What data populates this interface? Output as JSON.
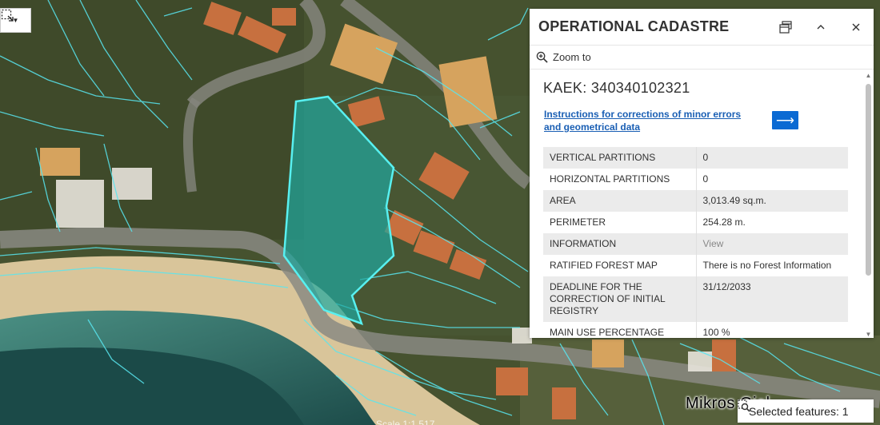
{
  "panel": {
    "title": "OPERATIONAL CADASTRE",
    "zoom_label": "Zoom to",
    "kaek": "KAEK: 340340102321",
    "instructions_link": "Instructions for corrections of minor errors and geometrical data",
    "arrow_glyph": "⟶",
    "attributes": [
      {
        "key": "VERTICAL PARTITIONS",
        "value": "0"
      },
      {
        "key": "HORIZONTAL PARTITIONS",
        "value": "0"
      },
      {
        "key": "AREA",
        "value": "3,013.49 sq.m."
      },
      {
        "key": "PERIMETER",
        "value": "254.28 m."
      },
      {
        "key": "INFORMATION",
        "value": "View"
      },
      {
        "key": "RATIFIED FOREST MAP",
        "value": "There is no Forest Information"
      },
      {
        "key": "DEADLINE FOR THE CORRECTION OF INITIAL REGISTRY",
        "value": "31/12/2033"
      },
      {
        "key": "MAIN USE PERCENTAGE",
        "value": "100 %"
      }
    ],
    "icons": [
      "dock-icon",
      "collapse-icon",
      "close-icon",
      "zoom-in-icon"
    ]
  },
  "map": {
    "place_label": "Mikros Gial",
    "scale_label": "Scale 1:1,517",
    "selected_features": "Selected features: 1",
    "parcel_color": "#1fa8a0",
    "boundary_color": "#58e6f0"
  }
}
